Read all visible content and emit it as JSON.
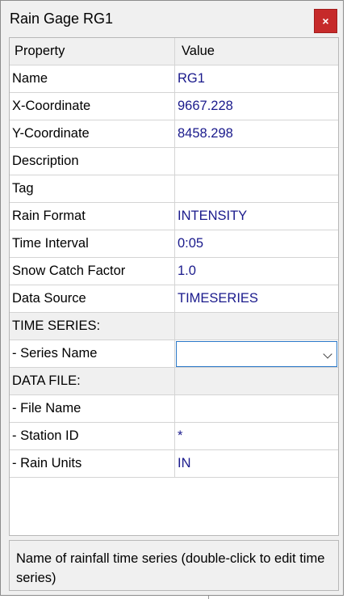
{
  "window": {
    "title": "Rain Gage RG1",
    "close_glyph": "×"
  },
  "grid": {
    "columns": [
      "Property",
      "Value"
    ],
    "rows": [
      {
        "property": "Name",
        "value": "RG1"
      },
      {
        "property": "X-Coordinate",
        "value": "9667.228"
      },
      {
        "property": "Y-Coordinate",
        "value": "8458.298"
      },
      {
        "property": "Description",
        "value": ""
      },
      {
        "property": "Tag",
        "value": ""
      },
      {
        "property": "Rain Format",
        "value": "INTENSITY"
      },
      {
        "property": "Time Interval",
        "value": "0:05"
      },
      {
        "property": "Snow Catch Factor",
        "value": "1.0"
      },
      {
        "property": "Data Source",
        "value": "TIMESERIES"
      },
      {
        "property": "TIME SERIES:",
        "value": ""
      },
      {
        "property": " - Series Name",
        "value": ""
      },
      {
        "property": "DATA FILE:",
        "value": ""
      },
      {
        "property": " - File Name",
        "value": ""
      },
      {
        "property": " - Station ID",
        "value": "*"
      },
      {
        "property": " - Rain Units",
        "value": "IN"
      }
    ]
  },
  "status_bar": {
    "text": "Name of rainfall time series (double-click to edit time series)"
  },
  "colors": {
    "value_text": "#1a1a8c",
    "close_button": "#c62a2a",
    "dropdown_focus_border": "#2a78c8"
  }
}
